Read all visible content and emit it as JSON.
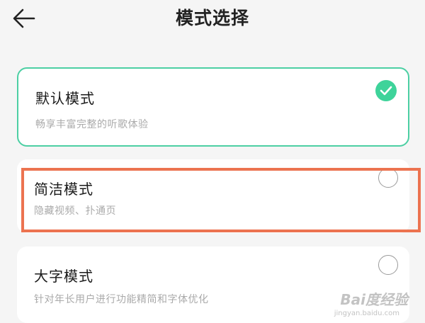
{
  "header": {
    "title": "模式选择",
    "back_icon": "arrow-left-icon"
  },
  "modes": [
    {
      "title": "默认模式",
      "desc": "畅享丰富完整的听歌体验",
      "selected": true
    },
    {
      "title": "简洁模式",
      "desc": "隐藏视频、扑通页",
      "selected": false
    },
    {
      "title": "大字模式",
      "desc": "针对年长用户进行功能精简和字体优化",
      "selected": false
    }
  ],
  "colors": {
    "accent": "#3ed39a",
    "selected_border": "#4ccfa3",
    "annotation": "#ec7350"
  },
  "watermark": {
    "brand": "Bai度经验",
    "url": "jingyan.baidu.com"
  }
}
